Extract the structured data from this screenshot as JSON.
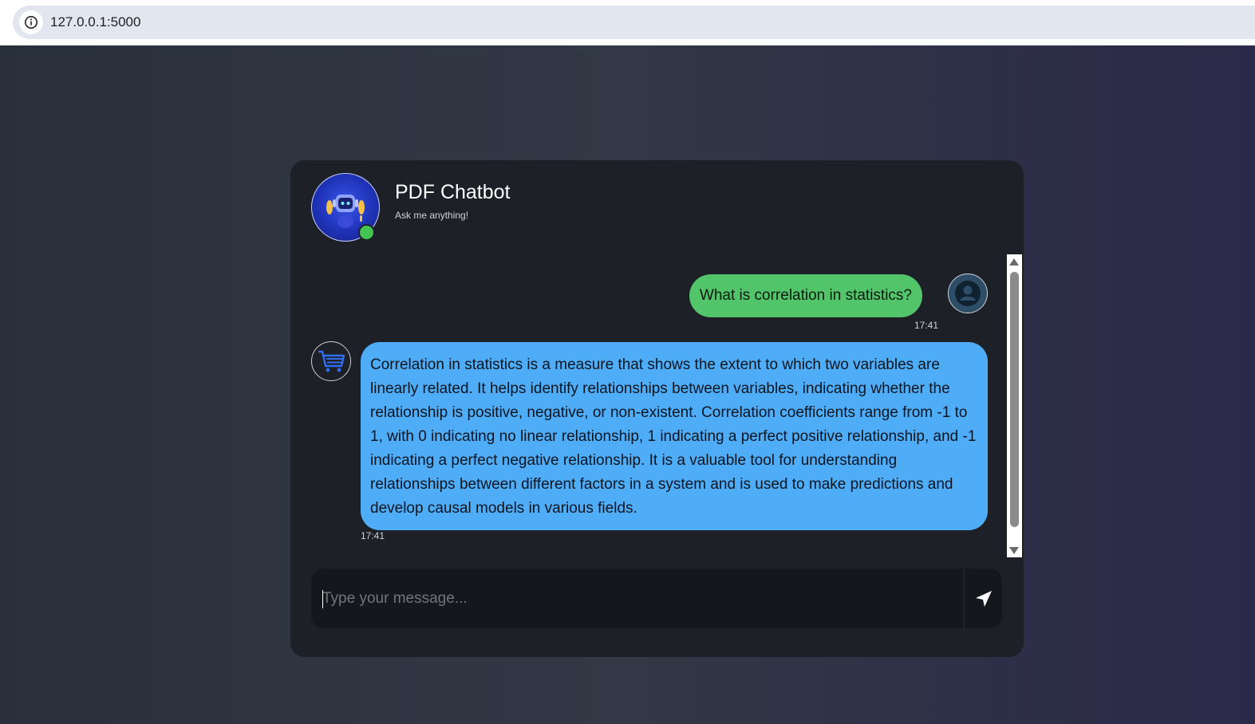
{
  "browser": {
    "url": "127.0.0.1:5000",
    "info_icon": "info-circle-icon"
  },
  "chat": {
    "title": "PDF Chatbot",
    "subtitle": "Ask me anything!",
    "bot_status": "online",
    "messages": [
      {
        "sender": "user",
        "text": "What is correlation in statistics?",
        "time": "17:41",
        "avatar_icon": "user-icon"
      },
      {
        "sender": "bot",
        "text": "Correlation in statistics is a measure that shows the extent to which two variables are linearly related. It helps identify relationships between variables, indicating whether the relationship is positive, negative, or non-existent. Correlation coefficients range from -1 to 1, with 0 indicating no linear relationship, 1 indicating a perfect positive relationship, and -1 indicating a perfect negative relationship. It is a valuable tool for understanding relationships between different factors in a system and is used to make predictions and develop causal models in various fields.",
        "time": "17:41",
        "avatar_icon": "shopping-cart-icon"
      }
    ]
  },
  "input": {
    "placeholder": "Type your message...",
    "value": "",
    "send_icon": "paper-plane-icon"
  },
  "colors": {
    "user_bubble": "#52c56a",
    "bot_bubble": "#4facf7",
    "card_background": "#1e2028",
    "status_online": "#43c453"
  }
}
